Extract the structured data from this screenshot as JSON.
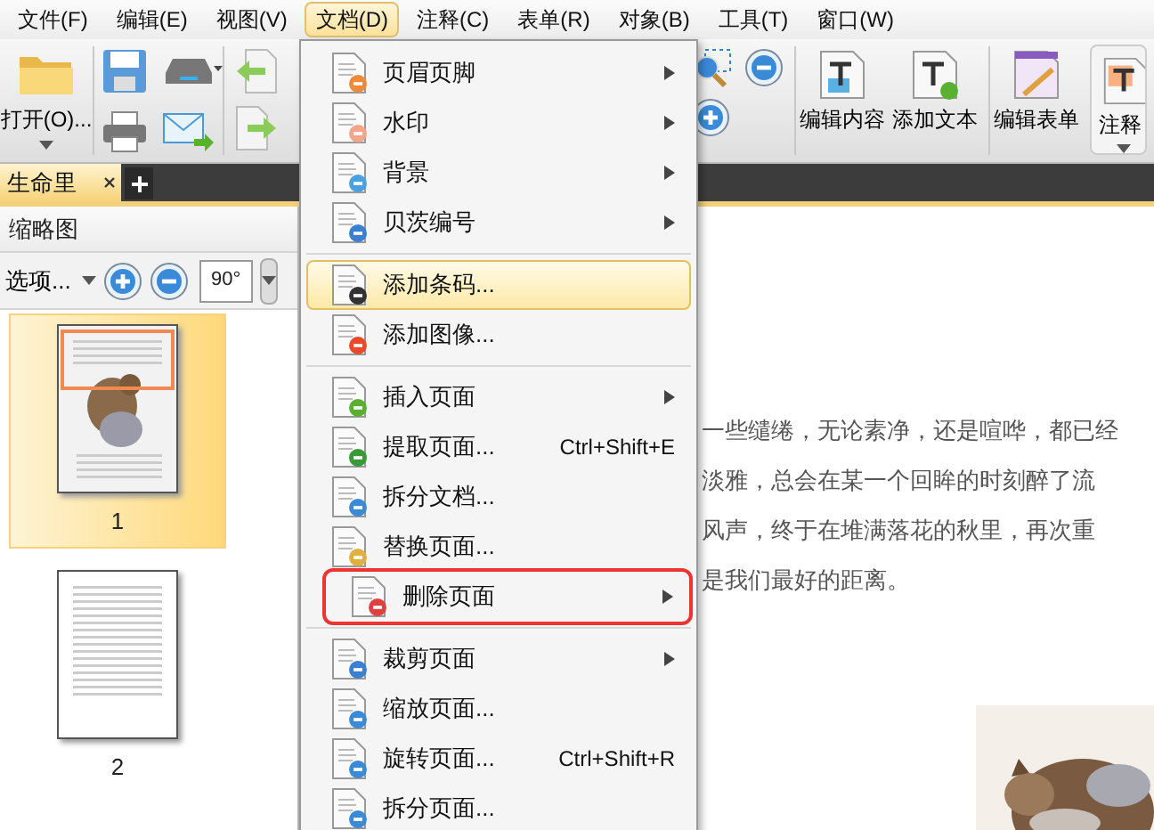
{
  "menu_bar": [
    {
      "label": "文件(F)",
      "selected": false
    },
    {
      "label": "编辑(E)",
      "selected": false
    },
    {
      "label": "视图(V)",
      "selected": false
    },
    {
      "label": "文档(D)",
      "selected": true
    },
    {
      "label": "注释(C)",
      "selected": false
    },
    {
      "label": "表单(R)",
      "selected": false
    },
    {
      "label": "对象(B)",
      "selected": false
    },
    {
      "label": "工具(T)",
      "selected": false
    },
    {
      "label": "窗口(W)",
      "selected": false
    }
  ],
  "toolbar": {
    "open_label": "打开(O)...",
    "right_buttons": [
      {
        "label": "编辑内容"
      },
      {
        "label": "添加文本"
      },
      {
        "label": "编辑表单"
      },
      {
        "label": "注释"
      }
    ]
  },
  "tabs": [
    {
      "label": "生命里",
      "selected": true
    }
  ],
  "thumbnail_panel": {
    "title": "缩略图",
    "options": "选项...",
    "rotate_label": "90°",
    "pages": [
      {
        "label": "1",
        "selected": true
      },
      {
        "label": "2",
        "selected": false
      }
    ]
  },
  "document": {
    "lines": [
      "一些缱绻，无论素净，还是喧哗，都已经",
      "淡雅，总会在某一个回眸的时刻醉了流",
      "风声，终于在堆满落花的秋里，再次重",
      "是我们最好的距离。"
    ]
  },
  "dropdown": {
    "groups": [
      [
        {
          "label": "页眉页脚",
          "submenu": true,
          "selected": false,
          "annotated": false
        },
        {
          "label": "水印",
          "submenu": true,
          "selected": false,
          "annotated": false
        },
        {
          "label": "背景",
          "submenu": true,
          "selected": false,
          "annotated": false
        },
        {
          "label": "贝茨编号",
          "submenu": true,
          "selected": false,
          "annotated": false
        }
      ],
      [
        {
          "label": "添加条码...",
          "submenu": false,
          "selected": true,
          "annotated": false
        },
        {
          "label": "添加图像...",
          "submenu": false,
          "selected": false,
          "annotated": false
        }
      ],
      [
        {
          "label": "插入页面",
          "submenu": true,
          "selected": false,
          "annotated": false
        },
        {
          "label": "提取页面...",
          "shortcut": "Ctrl+Shift+E",
          "submenu": false,
          "selected": false,
          "annotated": false
        },
        {
          "label": "拆分文档...",
          "submenu": false,
          "selected": false,
          "annotated": false
        },
        {
          "label": "替换页面...",
          "submenu": false,
          "selected": false,
          "annotated": false
        },
        {
          "label": "删除页面",
          "submenu": true,
          "selected": false,
          "annotated": true
        }
      ],
      [
        {
          "label": "裁剪页面",
          "submenu": true,
          "selected": false,
          "annotated": false
        },
        {
          "label": "缩放页面...",
          "submenu": false,
          "selected": false,
          "annotated": false
        },
        {
          "label": "旋转页面...",
          "shortcut": "Ctrl+Shift+R",
          "submenu": false,
          "selected": false,
          "annotated": false
        },
        {
          "label": "拆分页面...",
          "submenu": false,
          "selected": false,
          "annotated": false
        }
      ]
    ]
  }
}
